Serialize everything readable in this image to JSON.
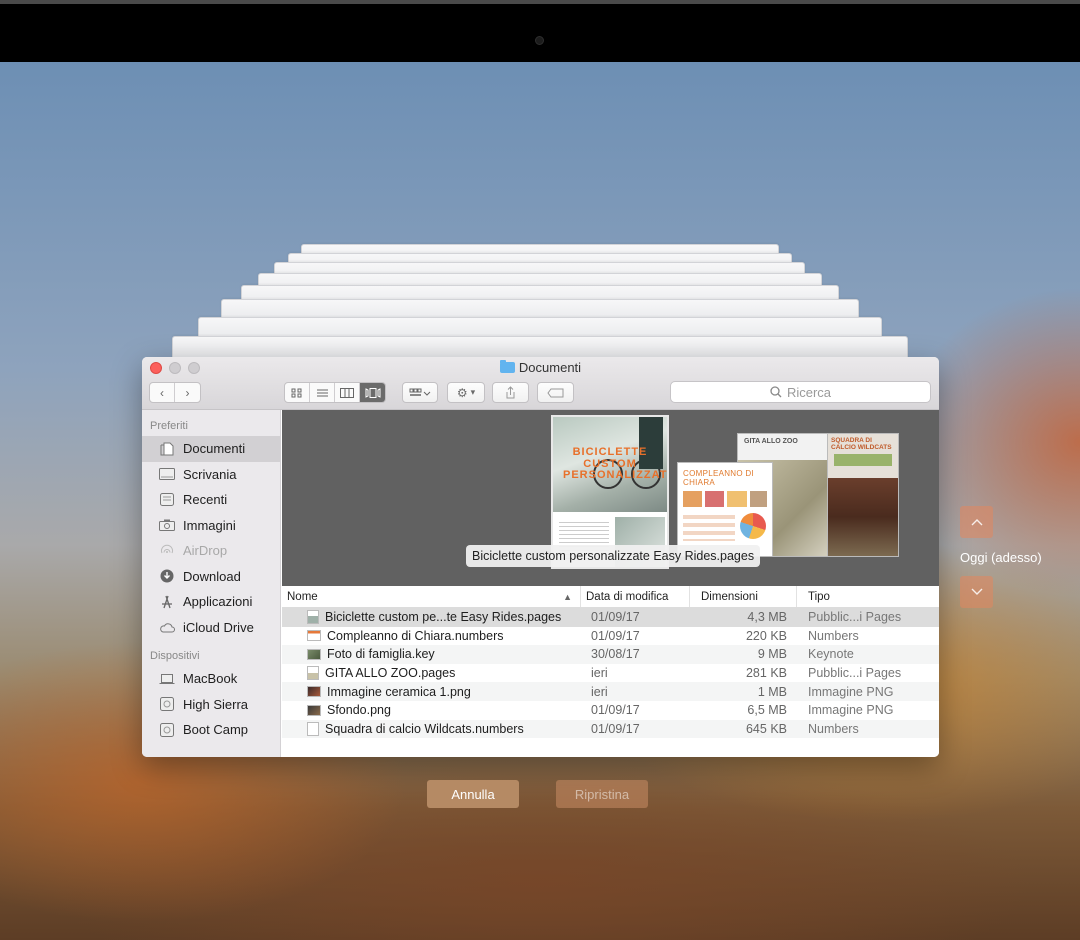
{
  "window": {
    "title": "Documenti",
    "search_placeholder": "Ricerca"
  },
  "sidebar": {
    "favorites_header": "Preferiti",
    "favorites": [
      {
        "label": "Documenti",
        "icon": "documents-icon",
        "selected": true
      },
      {
        "label": "Scrivania",
        "icon": "desktop-icon"
      },
      {
        "label": "Recenti",
        "icon": "recents-icon"
      },
      {
        "label": "Immagini",
        "icon": "camera-icon"
      },
      {
        "label": "AirDrop",
        "icon": "airdrop-icon",
        "dim": true
      },
      {
        "label": "Download",
        "icon": "download-icon"
      },
      {
        "label": "Applicazioni",
        "icon": "applications-icon"
      },
      {
        "label": "iCloud Drive",
        "icon": "cloud-icon"
      }
    ],
    "devices_header": "Dispositivi",
    "devices": [
      {
        "label": "MacBook",
        "icon": "laptop-icon"
      },
      {
        "label": "High Sierra",
        "icon": "disk-icon"
      },
      {
        "label": "Boot Camp",
        "icon": "disk-icon"
      }
    ]
  },
  "coverflow": {
    "caption": "Biciclette custom personalizzate Easy Rides.pages",
    "doc1_title": "BICICLETTE CUSTOM PERSONALIZZATE",
    "doc2_title": "COMPLEANNO DI CHIARA",
    "doc3_title": "GITA ALLO ZOO",
    "doc4_title": "SQUADRA DI CALCIO WILDCATS"
  },
  "table": {
    "headers": {
      "name": "Nome",
      "date": "Data di modifica",
      "size": "Dimensioni",
      "kind": "Tipo"
    },
    "rows": [
      {
        "name": "Biciclette custom pe...te Easy Rides.pages",
        "date": "01/09/17",
        "size": "4,3 MB",
        "kind": "Pubblic...i Pages"
      },
      {
        "name": "Compleanno di Chiara.numbers",
        "date": "01/09/17",
        "size": "220 KB",
        "kind": "Numbers"
      },
      {
        "name": "Foto di famiglia.key",
        "date": "30/08/17",
        "size": "9 MB",
        "kind": "Keynote"
      },
      {
        "name": "GITA ALLO ZOO.pages",
        "date": "ieri",
        "size": "281 KB",
        "kind": "Pubblic...i Pages"
      },
      {
        "name": "Immagine ceramica 1.png",
        "date": "ieri",
        "size": "1 MB",
        "kind": "Immagine PNG"
      },
      {
        "name": "Sfondo.png",
        "date": "01/09/17",
        "size": "6,5 MB",
        "kind": "Immagine PNG"
      },
      {
        "name": "Squadra di calcio Wildcats.numbers",
        "date": "01/09/17",
        "size": "645 KB",
        "kind": "Numbers"
      }
    ]
  },
  "timeline": {
    "label": "Oggi (adesso)"
  },
  "buttons": {
    "cancel": "Annulla",
    "restore": "Ripristina"
  },
  "colors": {
    "accent_button": "#b58a64",
    "close_button": "#fc605c",
    "folder_blue": "#62b4ef"
  }
}
